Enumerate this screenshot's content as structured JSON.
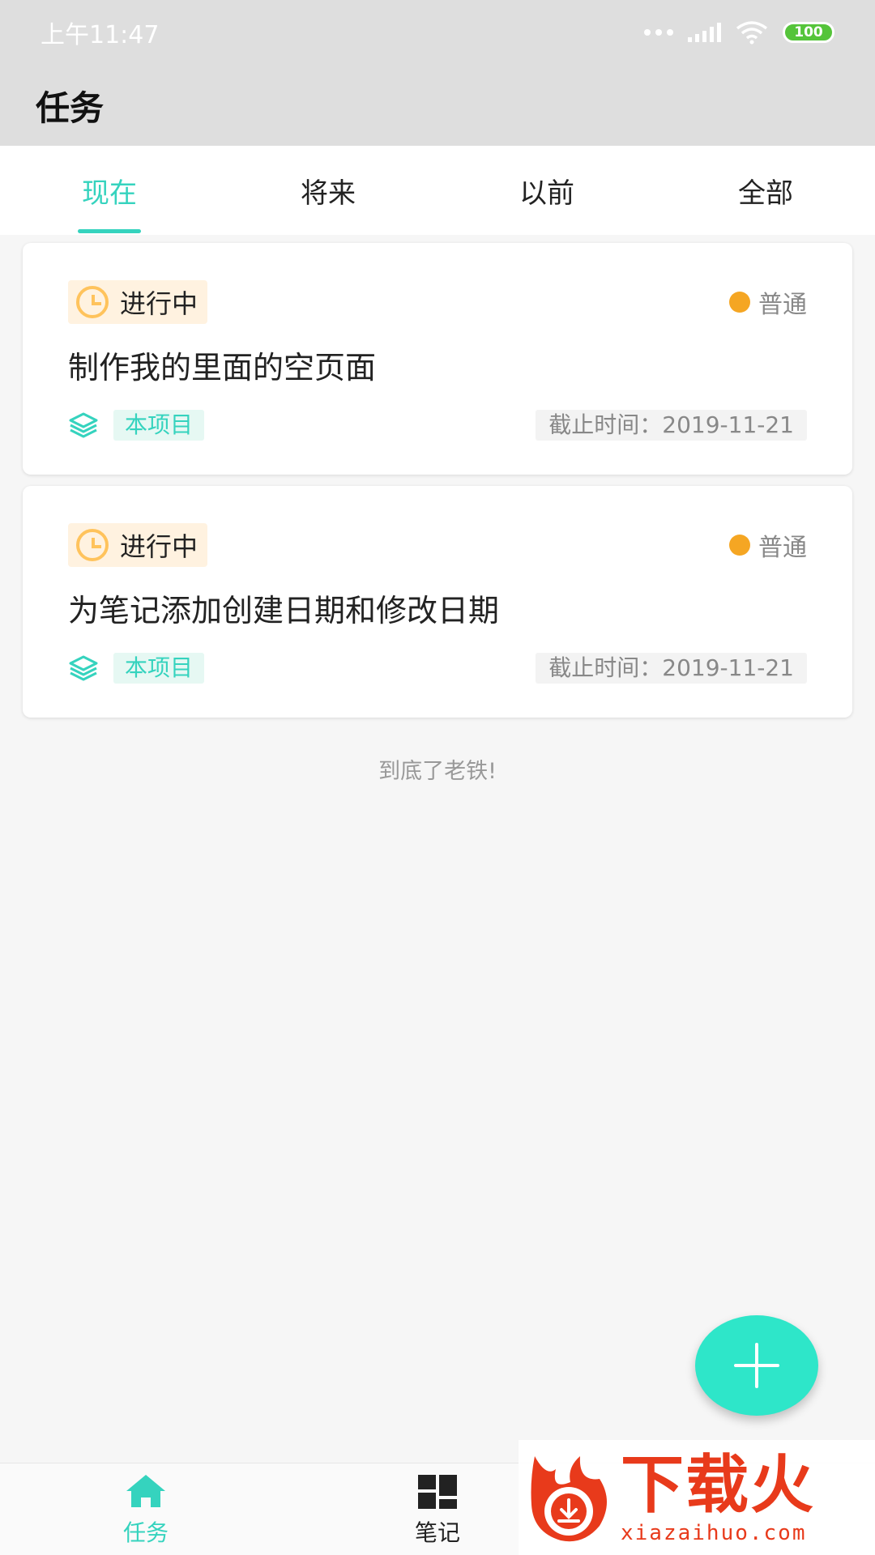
{
  "status_bar": {
    "time": "上午11:47",
    "battery": "100"
  },
  "app_bar": {
    "title": "任务"
  },
  "tabs": [
    {
      "label": "现在",
      "active": true
    },
    {
      "label": "将来",
      "active": false
    },
    {
      "label": "以前",
      "active": false
    },
    {
      "label": "全部",
      "active": false
    }
  ],
  "tasks": [
    {
      "status": "进行中",
      "priority": "普通",
      "title": "制作我的里面的空页面",
      "project": "本项目",
      "deadline": "截止时间：2019-11-21"
    },
    {
      "status": "进行中",
      "priority": "普通",
      "title": "为笔记添加创建日期和修改日期",
      "project": "本项目",
      "deadline": "截止时间：2019-11-21"
    }
  ],
  "list_end": "到底了老铁!",
  "bottom_nav": [
    {
      "label": "任务",
      "icon": "home-icon",
      "active": true
    },
    {
      "label": "笔记",
      "icon": "dashboard-icon",
      "active": false
    }
  ],
  "watermark": {
    "title": "下载火",
    "url": "xiazaihuo.com"
  },
  "colors": {
    "accent": "#35d3be",
    "fab": "#2ee6c9",
    "priority_normal": "#f5a623",
    "status_chip_bg": "#fff2e0"
  }
}
